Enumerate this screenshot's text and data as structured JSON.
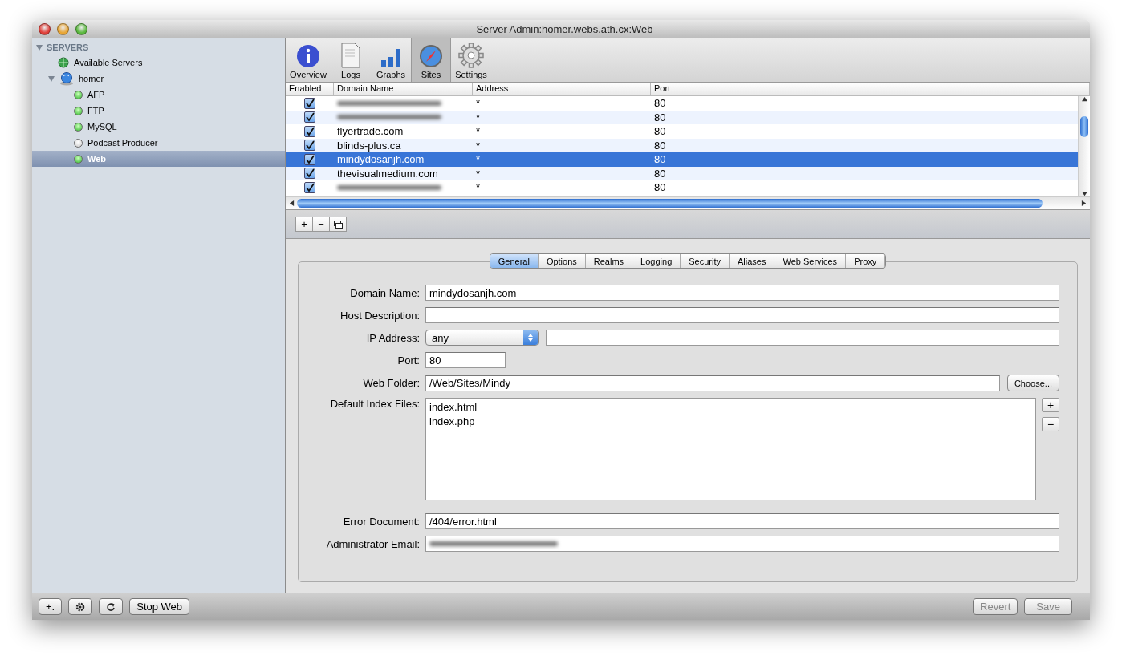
{
  "window": {
    "title": "Server Admin:homer.webs.ath.cx:Web"
  },
  "sidebar": {
    "heading": "SERVERS",
    "expanded": true,
    "items": [
      {
        "label": "Available Servers",
        "kind": "group",
        "selected": false
      },
      {
        "label": "homer",
        "kind": "server",
        "expanded": true,
        "selected": false,
        "children": [
          {
            "label": "AFP",
            "kind": "service",
            "running": true,
            "selected": false
          },
          {
            "label": "FTP",
            "kind": "service",
            "running": true,
            "selected": false
          },
          {
            "label": "MySQL",
            "kind": "service",
            "running": true,
            "selected": false
          },
          {
            "label": "Podcast Producer",
            "kind": "service",
            "running": false,
            "selected": false
          },
          {
            "label": "Web",
            "kind": "service",
            "running": true,
            "selected": true
          }
        ]
      }
    ]
  },
  "toolbar": [
    {
      "label": "Overview",
      "selected": false
    },
    {
      "label": "Logs",
      "selected": false
    },
    {
      "label": "Graphs",
      "selected": false
    },
    {
      "label": "Sites",
      "selected": true
    },
    {
      "label": "Settings",
      "selected": false
    }
  ],
  "sites_table": {
    "columns": [
      "Enabled",
      "Domain Name",
      "Address",
      "Port"
    ],
    "rows": [
      {
        "enabled": true,
        "domain": "",
        "redacted": true,
        "address": "*",
        "port": "80",
        "selected": false
      },
      {
        "enabled": true,
        "domain": "",
        "redacted": true,
        "address": "*",
        "port": "80",
        "selected": false
      },
      {
        "enabled": true,
        "domain": "flyertrade.com",
        "redacted": false,
        "address": "*",
        "port": "80",
        "selected": false
      },
      {
        "enabled": true,
        "domain": "blinds-plus.ca",
        "redacted": false,
        "address": "*",
        "port": "80",
        "selected": false
      },
      {
        "enabled": true,
        "domain": "mindydosanjh.com",
        "redacted": false,
        "address": "*",
        "port": "80",
        "selected": true
      },
      {
        "enabled": true,
        "domain": "thevisualmedium.com",
        "redacted": false,
        "address": "*",
        "port": "80",
        "selected": false
      },
      {
        "enabled": true,
        "domain": "",
        "redacted": true,
        "address": "*",
        "port": "80",
        "selected": false
      }
    ]
  },
  "table_buttons": [
    "+",
    "−"
  ],
  "tabs": [
    {
      "label": "General",
      "selected": true
    },
    {
      "label": "Options",
      "selected": false
    },
    {
      "label": "Realms",
      "selected": false
    },
    {
      "label": "Logging",
      "selected": false
    },
    {
      "label": "Security",
      "selected": false
    },
    {
      "label": "Aliases",
      "selected": false
    },
    {
      "label": "Web Services",
      "selected": false
    },
    {
      "label": "Proxy",
      "selected": false
    }
  ],
  "form": {
    "domain_name": {
      "label": "Domain Name:",
      "value": "mindydosanjh.com"
    },
    "host_description": {
      "label": "Host Description:"
    },
    "ip_address": {
      "label": "IP Address:",
      "value": "any"
    },
    "port": {
      "label": "Port:",
      "value": "80"
    },
    "web_folder": {
      "label": "Web Folder:",
      "value": "/Web/Sites/Mindy",
      "button": "Choose..."
    },
    "default_index_files": {
      "label": "Default Index Files:",
      "items": [
        "index.html",
        "index.php"
      ],
      "buttons": [
        "+",
        "−"
      ]
    },
    "error_document": {
      "label": "Error Document:",
      "value": "/404/error.html"
    },
    "administrator_email": {
      "label": "Administrator Email:",
      "redacted": true
    }
  },
  "bottom_bar": {
    "buttons": [
      {
        "label": "+.",
        "kind": "icon"
      },
      {
        "kind": "gear"
      },
      {
        "kind": "refresh"
      },
      {
        "label": "Stop Web",
        "kind": "text"
      }
    ],
    "revert": {
      "label": "Revert",
      "disabled": true
    },
    "save": {
      "label": "Save",
      "disabled": true
    }
  }
}
